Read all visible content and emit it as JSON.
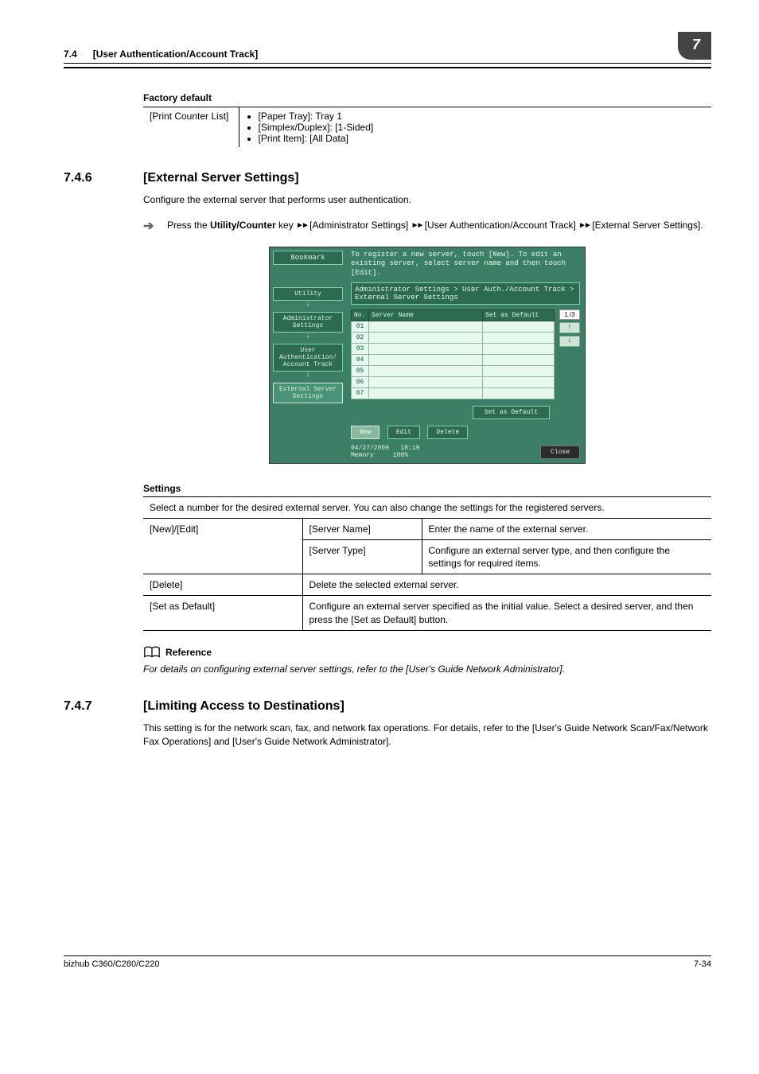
{
  "header": {
    "section_no": "7.4",
    "section_title": "[User Authentication/Account Track]",
    "tab": "7"
  },
  "factory": {
    "heading": "Factory default",
    "col1": "[Print Counter List]",
    "items": [
      "[Paper Tray]: Tray 1",
      "[Simplex/Duplex]: [1-Sided]",
      "[Print Item]: [All Data]"
    ]
  },
  "sec746": {
    "num": "7.4.6",
    "title": "[External Server Settings]",
    "intro": "Configure the external server that performs user authentication.",
    "path_prefix": "Press the ",
    "path_key": "Utility/Counter",
    "path_parts": [
      " key ",
      " [Administrator Settings] ",
      " [User Authentication/Account Track] ",
      " [External Server Settings]."
    ]
  },
  "panel": {
    "bookmark": "Bookmark",
    "crumbs": [
      "Utility",
      "Administrator Settings",
      "User Authentication/ Account Track",
      "External Server Settings"
    ],
    "top_text": "To register a new server, touch [New]. To edit an existing server, select server name and then touch [Edit].",
    "breadcrumb_bar": "Administrator Settings > User Auth./Account Track > External Server Settings",
    "th_no": "No.",
    "th_name": "Server Name",
    "th_default": "Set as Default",
    "rows": [
      "01",
      "02",
      "03",
      "04",
      "05",
      "06",
      "07"
    ],
    "pager": "1 /3",
    "set_default_btn": "Set as Default",
    "new_btn": "New",
    "edit_btn": "Edit",
    "delete_btn": "Delete",
    "status_date": "04/27/2009",
    "status_time": "18:19",
    "status_mem_lbl": "Memory",
    "status_mem_val": "100%",
    "close_btn": "Close"
  },
  "settings": {
    "heading": "Settings",
    "intro": "Select a number for the desired external server. You can also change the settings for the registered servers.",
    "r1_a": "[New]/[Edit]",
    "r1_b": "[Server Name]",
    "r1_c": "Enter the name of the external server.",
    "r2_b": "[Server Type]",
    "r2_c": "Configure an external server type, and then configure the settings for required items.",
    "r3_a": "[Delete]",
    "r3_bc": "Delete the selected external server.",
    "r4_a": "[Set as Default]",
    "r4_bc": "Configure an external server specified as the initial value. Select a desired server, and then press the [Set as Default] button."
  },
  "reference": {
    "label": "Reference",
    "text": "For details on configuring external server settings, refer to the [User's Guide Network Administrator]."
  },
  "sec747": {
    "num": "7.4.7",
    "title": "[Limiting Access to Destinations]",
    "body": "This setting is for the network scan, fax, and network fax operations. For details, refer to the [User's Guide Network Scan/Fax/Network Fax Operations] and [User's Guide Network Administrator]."
  },
  "footer": {
    "left": "bizhub C360/C280/C220",
    "right": "7-34"
  }
}
